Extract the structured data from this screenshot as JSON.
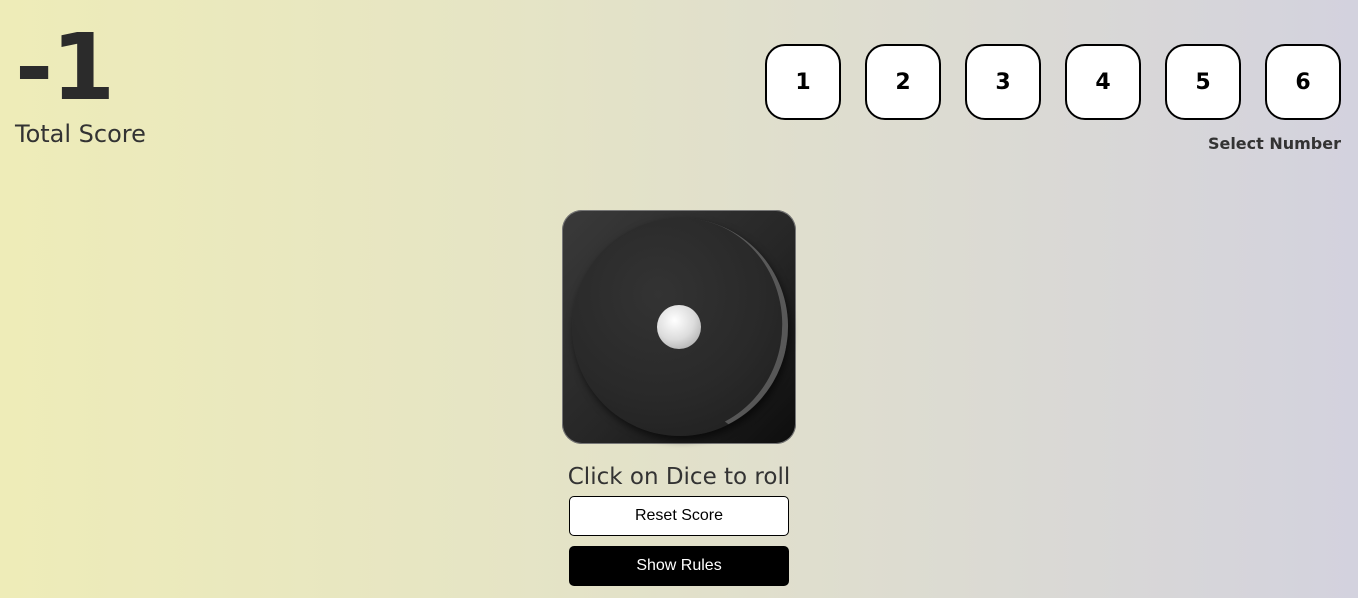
{
  "score": {
    "value": "-1",
    "label": "Total Score"
  },
  "selector": {
    "numbers": [
      "1",
      "2",
      "3",
      "4",
      "5",
      "6"
    ],
    "label": "Select Number"
  },
  "dice": {
    "face": 1,
    "instruction": "Click on Dice to roll"
  },
  "buttons": {
    "reset": "Reset Score",
    "rules": "Show Rules"
  },
  "colors": {
    "primary_button": "#000000",
    "dice_body": "#262626"
  }
}
